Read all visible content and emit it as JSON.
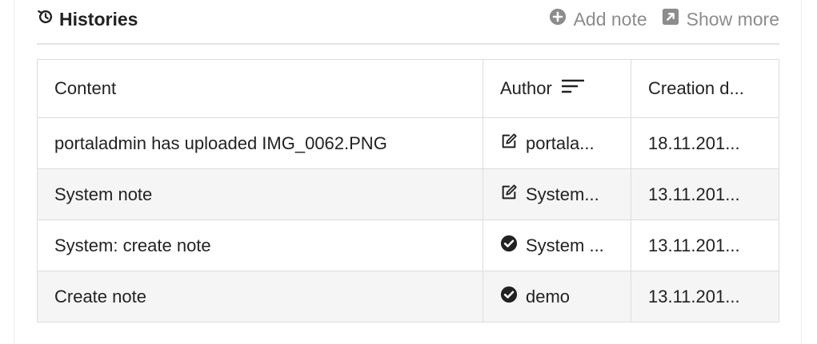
{
  "header": {
    "title": "Histories",
    "add_note_label": "Add note",
    "show_more_label": "Show more"
  },
  "table": {
    "columns": [
      "Content",
      "Author",
      "Creation d..."
    ],
    "rows": [
      {
        "content": "portaladmin has uploaded IMG_0062.PNG",
        "author": "portala...",
        "author_icon": "edit-icon",
        "date": "18.11.201..."
      },
      {
        "content": "System note",
        "author": "System...",
        "author_icon": "edit-icon",
        "date": "13.11.201..."
      },
      {
        "content": "System: create note",
        "author": "System ...",
        "author_icon": "check-circle-icon",
        "date": "13.11.201..."
      },
      {
        "content": "Create note",
        "author": "demo",
        "author_icon": "check-circle-icon",
        "date": "13.11.201..."
      }
    ]
  },
  "colors": {
    "muted": "#8c8c8c",
    "border": "#dcdcdc",
    "row_alt": "#f5f5f5"
  }
}
